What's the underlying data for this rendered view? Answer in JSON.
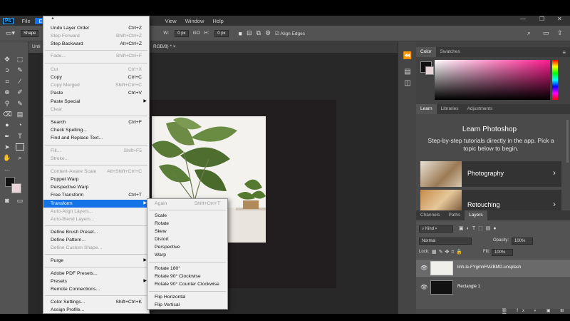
{
  "app": {
    "logo": "Ps"
  },
  "menubar": [
    "File",
    "Edit",
    "View",
    "Window",
    "Help"
  ],
  "options": {
    "shape_label": "Shape",
    "w_label": "W:",
    "w_value": "0 px",
    "link_label": "GO",
    "h_label": "H:",
    "h_value": "0 px",
    "align_edges": "Align Edges"
  },
  "document": {
    "tab_prefix": "Unti",
    "tab_suffix": "RGB/8) *",
    "tab_close": "×"
  },
  "edit_menu": {
    "items": [
      {
        "label": "Undo Layer Order",
        "shortcut": "Ctrl+Z",
        "enabled": true
      },
      {
        "label": "Step Forward",
        "shortcut": "Shift+Ctrl+Z",
        "enabled": false
      },
      {
        "label": "Step Backward",
        "shortcut": "Alt+Ctrl+Z",
        "enabled": true
      },
      {
        "label": "Fade...",
        "shortcut": "Shift+Ctrl+F",
        "enabled": false
      },
      {
        "label": "Cut",
        "shortcut": "Ctrl+X",
        "enabled": false
      },
      {
        "label": "Copy",
        "shortcut": "Ctrl+C",
        "enabled": true
      },
      {
        "label": "Copy Merged",
        "shortcut": "Shift+Ctrl+C",
        "enabled": false
      },
      {
        "label": "Paste",
        "shortcut": "Ctrl+V",
        "enabled": true
      },
      {
        "label": "Paste Special",
        "shortcut": "",
        "enabled": true,
        "submenu": true
      },
      {
        "label": "Clear",
        "shortcut": "",
        "enabled": false
      },
      {
        "label": "Search",
        "shortcut": "Ctrl+F",
        "enabled": true
      },
      {
        "label": "Check Spelling...",
        "shortcut": "",
        "enabled": true
      },
      {
        "label": "Find and Replace Text...",
        "shortcut": "",
        "enabled": true
      },
      {
        "label": "Fill...",
        "shortcut": "Shift+F5",
        "enabled": false
      },
      {
        "label": "Stroke...",
        "shortcut": "",
        "enabled": false
      },
      {
        "label": "Content-Aware Scale",
        "shortcut": "Alt+Shift+Ctrl+C",
        "enabled": false
      },
      {
        "label": "Puppet Warp",
        "shortcut": "",
        "enabled": true
      },
      {
        "label": "Perspective Warp",
        "shortcut": "",
        "enabled": true
      },
      {
        "label": "Free Transform",
        "shortcut": "Ctrl+T",
        "enabled": true
      },
      {
        "label": "Transform",
        "shortcut": "",
        "enabled": true,
        "submenu": true,
        "highlighted": true
      },
      {
        "label": "Auto-Align Layers...",
        "shortcut": "",
        "enabled": false
      },
      {
        "label": "Auto-Blend Layers...",
        "shortcut": "",
        "enabled": false
      },
      {
        "label": "Define Brush Preset...",
        "shortcut": "",
        "enabled": true
      },
      {
        "label": "Define Pattern...",
        "shortcut": "",
        "enabled": true
      },
      {
        "label": "Define Custom Shape...",
        "shortcut": "",
        "enabled": false
      },
      {
        "label": "Purge",
        "shortcut": "",
        "enabled": true,
        "submenu": true
      },
      {
        "label": "Adobe PDF Presets...",
        "shortcut": "",
        "enabled": true
      },
      {
        "label": "Presets",
        "shortcut": "",
        "enabled": true,
        "submenu": true
      },
      {
        "label": "Remote Connections...",
        "shortcut": "",
        "enabled": true
      },
      {
        "label": "Color Settings...",
        "shortcut": "Shift+Ctrl+K",
        "enabled": true
      },
      {
        "label": "Assign Profile...",
        "shortcut": "",
        "enabled": true
      }
    ]
  },
  "transform_menu": {
    "items": [
      {
        "label": "Again",
        "shortcut": "Shift+Ctrl+T",
        "enabled": false
      },
      {
        "label": "Scale",
        "shortcut": "",
        "enabled": true
      },
      {
        "label": "Rotate",
        "shortcut": "",
        "enabled": true
      },
      {
        "label": "Skew",
        "shortcut": "",
        "enabled": true
      },
      {
        "label": "Distort",
        "shortcut": "",
        "enabled": true
      },
      {
        "label": "Perspective",
        "shortcut": "",
        "enabled": true
      },
      {
        "label": "Warp",
        "shortcut": "",
        "enabled": true
      },
      {
        "label": "Rotate 180°",
        "shortcut": "",
        "enabled": true
      },
      {
        "label": "Rotate 90° Clockwise",
        "shortcut": "",
        "enabled": true
      },
      {
        "label": "Rotate 90° Counter Clockwise",
        "shortcut": "",
        "enabled": true
      },
      {
        "label": "Flip Horizontal",
        "shortcut": "",
        "enabled": true
      },
      {
        "label": "Flip Vertical",
        "shortcut": "",
        "enabled": true
      }
    ]
  },
  "color_panel": {
    "tabs": [
      "Color",
      "Swatches"
    ]
  },
  "learn_panel": {
    "tabs": [
      "Learn",
      "Libraries",
      "Adjustments"
    ],
    "title": "Learn Photoshop",
    "description": "Step-by-step tutorials directly in the app. Pick a topic below to begin.",
    "topics": [
      "Photography",
      "Retouching"
    ]
  },
  "layers_panel": {
    "tabs": [
      "Channels",
      "Paths",
      "Layers"
    ],
    "kind": "Kind",
    "blend_mode": "Normal",
    "opacity_label": "Opacity:",
    "opacity_value": "100%",
    "lock_label": "Lock:",
    "fill_label": "Fill:",
    "fill_value": "100%",
    "layers": [
      "linh-le-FYgmnFMZBMO-unsplash",
      "Rectangle 1"
    ]
  },
  "colors": {
    "accent": "#1473e6",
    "menu_bg": "#f0f0f0",
    "panel_bg": "#424242"
  }
}
